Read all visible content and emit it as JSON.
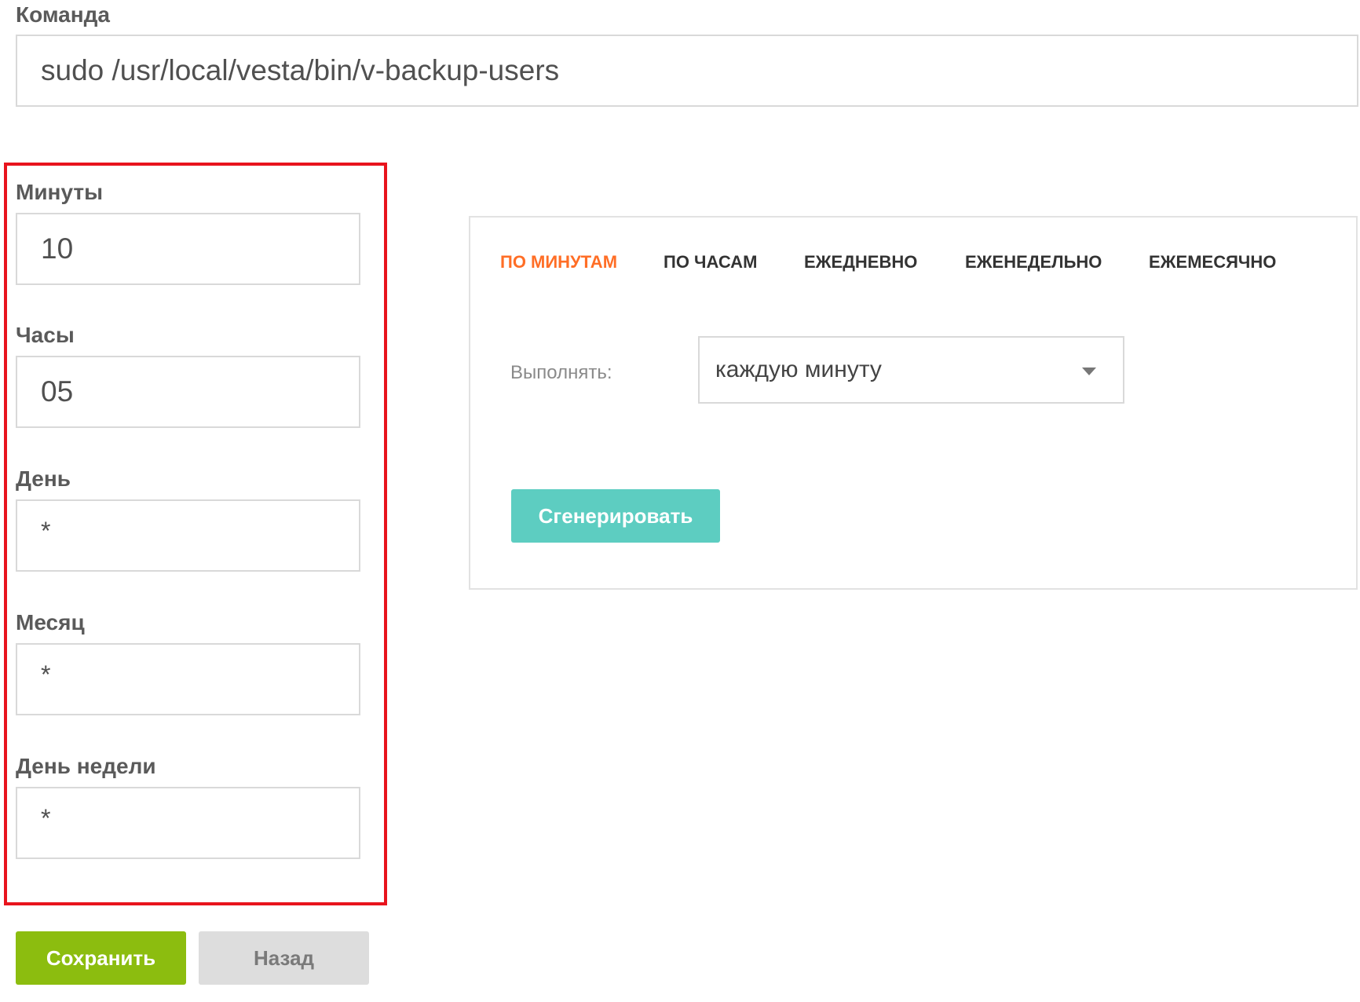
{
  "command": {
    "label": "Команда",
    "value": "sudo /usr/local/vesta/bin/v-backup-users"
  },
  "schedule_fields": {
    "minutes": {
      "label": "Минуты",
      "value": "10"
    },
    "hours": {
      "label": "Часы",
      "value": "05"
    },
    "day": {
      "label": "День",
      "value": "*"
    },
    "month": {
      "label": "Месяц",
      "value": "*"
    },
    "weekday": {
      "label": "День недели",
      "value": "*"
    }
  },
  "generator": {
    "tabs": [
      "ПО МИНУТАМ",
      "ПО ЧАСАМ",
      "ЕЖЕДНЕВНО",
      "ЕЖЕНЕДЕЛЬНО",
      "ЕЖЕМЕСЯЧНО"
    ],
    "active_tab": "ПО МИНУТАМ",
    "execute_label": "Выполнять:",
    "execute_selected": "каждую минуту",
    "generate_label": "Сгенерировать"
  },
  "actions": {
    "save_label": "Сохранить",
    "back_label": "Назад"
  },
  "colors": {
    "active_tab": "#ff6e26",
    "highlight_border": "#e8141d",
    "save_button": "#8cbd0f",
    "generate_button": "#5dcdc1",
    "back_button": "#dddddd"
  }
}
